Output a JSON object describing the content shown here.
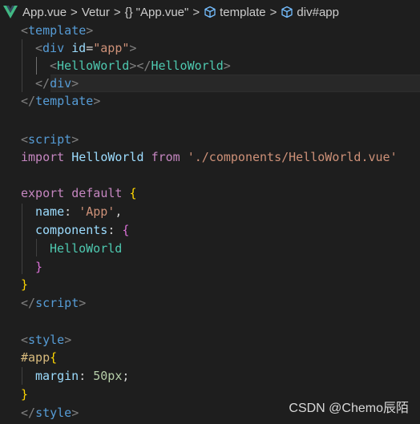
{
  "breadcrumb": {
    "file": "App.vue",
    "sep": ">",
    "extension": "Vetur",
    "braces": "{}",
    "object_name": "\"App.vue\"",
    "node_template": "template",
    "node_div": "div#app"
  },
  "code": {
    "l1_open": "<",
    "l1_tag": "template",
    "l1_close": ">",
    "l2_open": "<",
    "l2_tag": "div",
    "l2_attr": "id",
    "l2_eq": "=",
    "l2_val": "\"app\"",
    "l2_close": ">",
    "l3_open": "<",
    "l3_comp": "HelloWorld",
    "l3_mid": "></",
    "l3_comp2": "HelloWorld",
    "l3_close": ">",
    "l4_open": "</",
    "l4_tag": "div",
    "l4_close": ">",
    "l5_open": "</",
    "l5_tag": "template",
    "l5_close": ">",
    "l7_open": "<",
    "l7_tag": "script",
    "l7_close": ">",
    "l8_import": "import",
    "l8_name": "HelloWorld",
    "l8_from": "from",
    "l8_path": "'./components/HelloWorld.vue'",
    "l10_export": "export",
    "l10_default": "default",
    "l10_brace": "{",
    "l11_key": "name",
    "l11_colon": ": ",
    "l11_val": "'App'",
    "l11_comma": ",",
    "l12_key": "components",
    "l12_colon": ": ",
    "l12_brace": "{",
    "l13_item": "HelloWorld",
    "l14_brace": "}",
    "l15_brace": "}",
    "l16_open": "</",
    "l16_tag": "script",
    "l16_close": ">",
    "l18_open": "<",
    "l18_tag": "style",
    "l18_close": ">",
    "l19_selector": "#app",
    "l19_brace": "{",
    "l20_prop": "margin",
    "l20_colon": ": ",
    "l20_val": "50px",
    "l20_semi": ";",
    "l21_brace": "}",
    "l22_open": "</",
    "l22_tag": "style",
    "l22_close": ">"
  },
  "watermark": "CSDN @Chemo辰陌",
  "icons": {
    "vue": "vue-logo-icon",
    "braces": "object-braces-icon",
    "cube": "symbol-cube-icon"
  },
  "colors": {
    "background": "#1e1e1e",
    "tag": "#569cd6",
    "component": "#4ec9b0",
    "string": "#ce9178",
    "keyword": "#c586c0",
    "bracket_gold": "#ffd700",
    "bracket_pink": "#da70d6",
    "number": "#b5cea8",
    "selector": "#d7ba7d"
  }
}
